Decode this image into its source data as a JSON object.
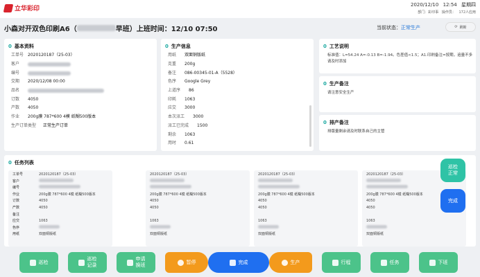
{
  "brand": {
    "name": "立华彩印"
  },
  "datetime": {
    "date": "2020/12/10",
    "time": "12:54",
    "weekday": "星期四",
    "dept": "部门：彩印事",
    "operator": "操作员：",
    "ip": "172人应用"
  },
  "title": {
    "prefix": "小森对开双色印刷A6（",
    "suffix": "早班）上班时间：12/10  07:50"
  },
  "status": {
    "label": "当前状态：",
    "value": "正常生产"
  },
  "refresh_label": "刷新",
  "basic": {
    "num": "0",
    "heading": "基本资料",
    "rows": [
      {
        "k": "工单号",
        "v": "2020120187（25-03）"
      },
      {
        "k": "客户",
        "v": ""
      },
      {
        "k": "编号",
        "v": ""
      },
      {
        "k": "交期",
        "v": "2020/12/08  00:00"
      },
      {
        "k": "品名",
        "v": ""
      },
      {
        "k": "订数",
        "v": "4050"
      },
      {
        "k": "产数",
        "v": "4050"
      },
      {
        "k": "作业",
        "v": "200g膜 787*600   4模   纸糊500版本"
      },
      {
        "k": "生产订单类型",
        "v": "正常生产订单"
      }
    ]
  },
  "prod": {
    "num": "0",
    "heading": "生产信息",
    "rows": [
      {
        "k": "用纸",
        "v": "双面铜版纸"
      },
      {
        "k": "克重",
        "v": "200g"
      },
      {
        "k": "备注",
        "v": "086-00345-01-A（5528）"
      },
      {
        "k": "色序",
        "v": "Google Grey"
      },
      {
        "k": "上道序",
        "v": "86"
      },
      {
        "k": "印耗",
        "v": "1063"
      },
      {
        "k": "应交",
        "v": "3000"
      },
      {
        "k": "本次派工",
        "v": "3000"
      },
      {
        "k": "派工已完成",
        "v": "1500"
      },
      {
        "k": "剩余",
        "v": "1063"
      },
      {
        "k": "用时",
        "v": "0.61"
      }
    ]
  },
  "craft": {
    "num": "0",
    "heading": "工艺说明",
    "text": "标准值：L=54.24  A=-0.13  B=-1.94。色差值<1.5；A1.印刷备注=按期，追量不多请及时添加"
  },
  "prodnote": {
    "num": "0",
    "heading": "生产备注",
    "text": "请注意安全生产"
  },
  "schedule": {
    "num": "0",
    "heading": "排产备注",
    "text": "排版量剩余请及时联系自己的主管"
  },
  "tasks": {
    "num": "0",
    "heading": "任务列表",
    "labels": [
      "工单号",
      "客户",
      "编号",
      "作业",
      "订数",
      "产数",
      "备注",
      "应交",
      "色序",
      "用纸"
    ],
    "cards": [
      {
        "order": "2020120187（25-03）",
        "job": "200g膜 787*600   4模   纸糊500版本",
        "qty": "4050",
        "prod": "4050",
        "due": "1063",
        "paper": "双面铜版纸"
      },
      {
        "order": "2020120187（25-03）",
        "job": "200g膜 787*600   4模   纸糊500版本",
        "qty": "4050",
        "prod": "4050",
        "due": "1063",
        "paper": "双面铜版纸"
      },
      {
        "order": "2020120187（25-03）",
        "job": "200g膜 787*600   4模   纸糊500版本",
        "qty": "4050",
        "prod": "4050",
        "due": "1063",
        "paper": "双面铜版纸"
      },
      {
        "order": "2020120187（25-03）",
        "job": "200g膜 787*600   4模   纸糊500版本",
        "qty": "4050",
        "prod": "4050",
        "due": "1063",
        "paper": "双面铜版纸"
      }
    ]
  },
  "fabs": {
    "check_normal": "巡检\n正常",
    "done": "完成"
  },
  "footer": {
    "inspect": "巡检",
    "inspect_record": "巡检\n记录",
    "change_shift": "申请\n换班",
    "pause": "暂停",
    "complete": "完成",
    "produce": "生产",
    "route": "行程",
    "task": "任务",
    "offwork": "下班"
  },
  "colors": {
    "accent": "#1f6ff0",
    "green": "#4cc38a",
    "orange": "#f39a1c",
    "teal": "#2fc3a6",
    "brand": "#d9232d"
  }
}
